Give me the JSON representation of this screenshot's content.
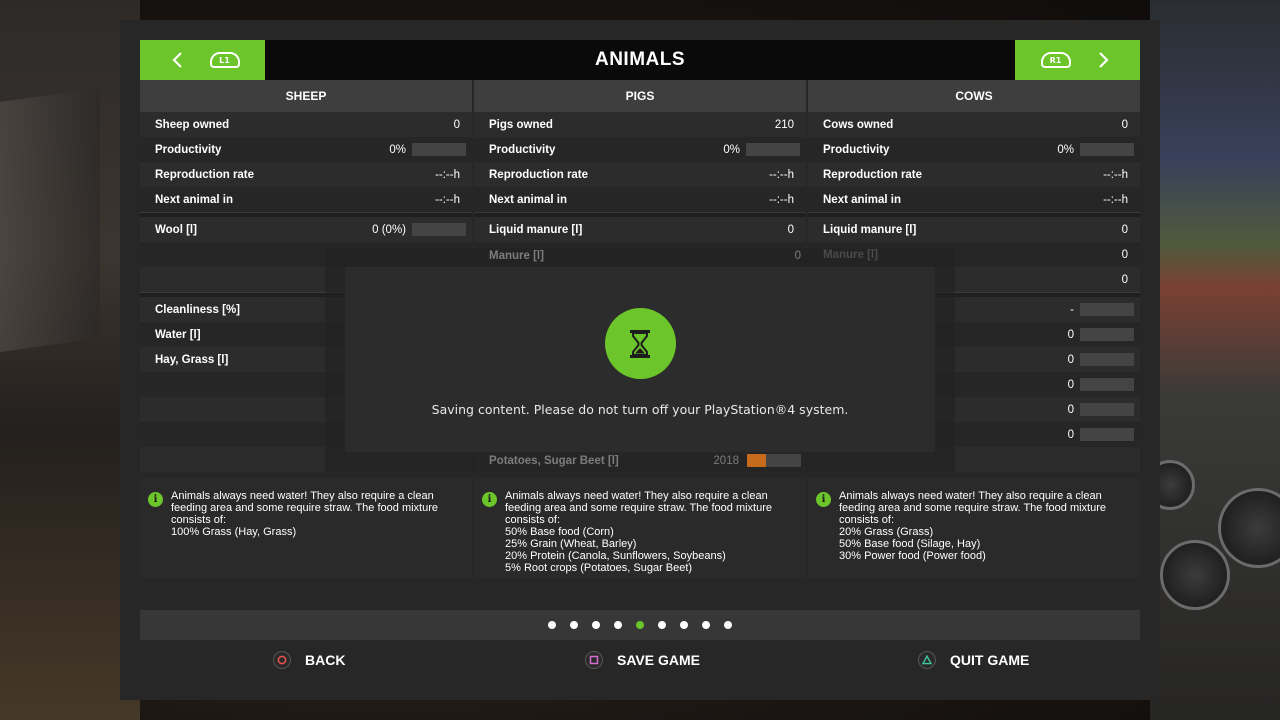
{
  "header": {
    "title": "ANIMALS",
    "left_button": "L1",
    "right_button": "R1"
  },
  "columns": [
    {
      "name": "SHEEP",
      "rows_top": [
        {
          "label": "Sheep owned",
          "value": "0",
          "bar": false
        },
        {
          "label": "Productivity",
          "value": "0%",
          "bar": true,
          "fill": 0
        },
        {
          "label": "Reproduction rate",
          "value": "--:--h",
          "bar": false
        },
        {
          "label": "Next animal in",
          "value": "--:--h",
          "bar": false
        }
      ],
      "rows_mid": [
        {
          "label": "Wool [l]",
          "value": "0 (0%)",
          "bar": true,
          "fill": 0
        }
      ],
      "rows_low": [
        {
          "label": "Cleanliness [%]",
          "value": "",
          "bar": false
        },
        {
          "label": "Water [l]",
          "value": "",
          "bar": false
        },
        {
          "label": "Hay, Grass [l]",
          "value": "",
          "bar": false
        }
      ],
      "info": [
        "Animals always need water! They also require a clean",
        "feeding area and some require straw. The food mixture",
        "consists of:",
        "100% Grass (Hay, Grass)"
      ]
    },
    {
      "name": "PIGS",
      "rows_top": [
        {
          "label": "Pigs owned",
          "value": "210",
          "bar": false
        },
        {
          "label": "Productivity",
          "value": "0%",
          "bar": true,
          "fill": 0
        },
        {
          "label": "Reproduction rate",
          "value": "--:--h",
          "bar": false
        },
        {
          "label": "Next animal in",
          "value": "--:--h",
          "bar": false
        }
      ],
      "rows_mid": [
        {
          "label": "Liquid manure [l]",
          "value": "0",
          "bar": false
        },
        {
          "label": "Manure [l]",
          "value": "0",
          "bar": false
        }
      ],
      "bottom_row": {
        "label": "Potatoes, Sugar Beet [l]",
        "value": "2018",
        "fill": 0.35
      },
      "info": [
        "Animals always need water! They also require a clean",
        "feeding area and some require straw. The food mixture",
        "consists of:",
        "50% Base food (Corn)",
        "25% Grain (Wheat, Barley)",
        "20% Protein (Canola, Sunflowers, Soybeans)",
        "5% Root crops (Potatoes, Sugar Beet)"
      ]
    },
    {
      "name": "COWS",
      "rows_top": [
        {
          "label": "Cows owned",
          "value": "0",
          "bar": false
        },
        {
          "label": "Productivity",
          "value": "0%",
          "bar": true,
          "fill": 0
        },
        {
          "label": "Reproduction rate",
          "value": "--:--h",
          "bar": false
        },
        {
          "label": "Next animal in",
          "value": "--:--h",
          "bar": false
        }
      ],
      "rows_mid": [
        {
          "label": "Liquid manure [l]",
          "value": "0",
          "bar": false
        },
        {
          "label": "Manure [l]",
          "value": "0",
          "bar": false
        },
        {
          "label": "",
          "value": "0",
          "bar": false
        }
      ],
      "rows_low": [
        {
          "label": "",
          "value": "-",
          "bar": true,
          "fill": 0
        },
        {
          "label": "",
          "value": "0",
          "bar": true,
          "fill": 0
        },
        {
          "label": "",
          "value": "0",
          "bar": true,
          "fill": 0
        },
        {
          "label": "",
          "value": "0",
          "bar": true,
          "fill": 0
        },
        {
          "label": "",
          "value": "0",
          "bar": true,
          "fill": 0
        },
        {
          "label": "",
          "value": "0",
          "bar": true,
          "fill": 0
        }
      ],
      "info": [
        "Animals always need water! They also require a clean",
        "feeding area and some require straw. The food mixture",
        "consists of:",
        "20% Grass (Grass)",
        "50% Base food (Silage, Hay)",
        "30% Power food (Power food)"
      ]
    }
  ],
  "pager": {
    "count": 9,
    "active_index": 4
  },
  "footer": {
    "back": "BACK",
    "save": "SAVE GAME",
    "quit": "QUIT GAME"
  },
  "modal": {
    "icon": "hourglass-icon",
    "message": "Saving content. Please do not turn off your PlayStation®4 system."
  },
  "colors": {
    "accent": "#6cc52b",
    "bar_fill": "#c66a1c",
    "circle_button": "#e0504f",
    "square_button": "#d46fd0",
    "triangle_button": "#3fc7a0"
  }
}
